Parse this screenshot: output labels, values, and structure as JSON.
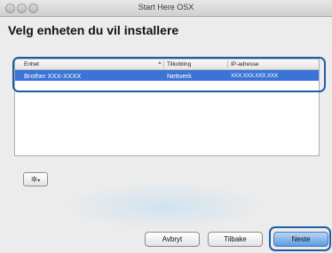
{
  "window": {
    "title": "Start Here OSX"
  },
  "page": {
    "heading": "Velg enheten du vil installere"
  },
  "table": {
    "columns": [
      "Enhet",
      "Tilkobling",
      "IP-adresse"
    ],
    "rows": [
      {
        "device": "Brother XXX-XXXX",
        "connection": "Nettverk",
        "ip": "XXX.XXX.XXX.XXX"
      }
    ],
    "selected_row": 0
  },
  "buttons": {
    "cancel": "Avbryt",
    "back": "Tilbake",
    "next": "Neste"
  },
  "icons": {
    "gear": "gear-icon",
    "dropdown": "chevron-down-icon",
    "sort": "sort-indicator-icon"
  },
  "colors": {
    "selection": "#3b74d6",
    "highlight_outline": "#1d5da7",
    "primary_button": "#5b9be3"
  }
}
